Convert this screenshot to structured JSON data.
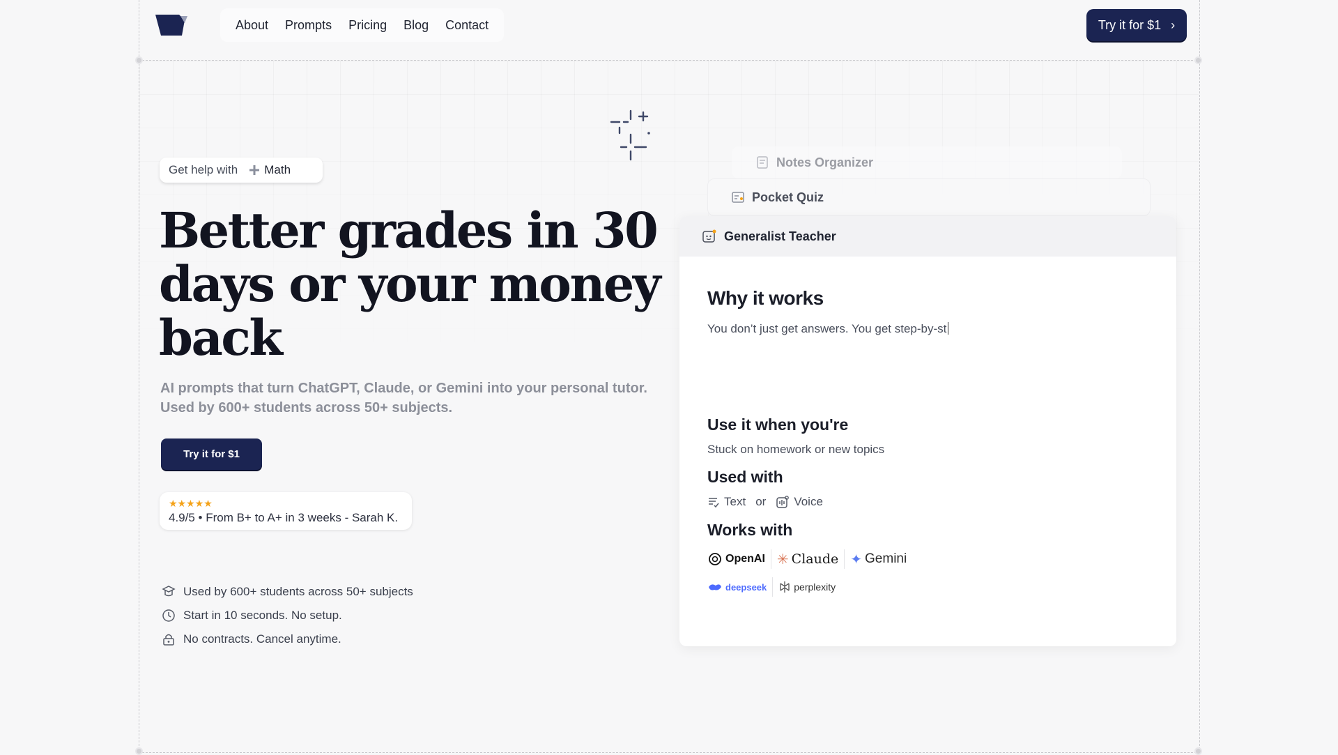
{
  "header": {
    "nav": [
      "About",
      "Prompts",
      "Pricing",
      "Blog",
      "Contact"
    ],
    "cta_label": "Try it for $1",
    "cta_chevron": "›"
  },
  "hero": {
    "help_prefix": "Get help with",
    "help_subject": "Math",
    "headline": "Better grades in 30 days or your money back",
    "subline": "AI prompts that turn ChatGPT, Claude, or Gemini into your personal tutor. Used by 600+ students across 50+ subjects.",
    "cta_label": "Try it for $1",
    "review_stars": "★★★★★",
    "review_text": "4.9/5 • From B+ to A+ in 3 weeks - Sarah K.",
    "bullets": [
      {
        "icon": "graduation-cap-icon",
        "text": "Used by 600+ students across 50+ subjects"
      },
      {
        "icon": "clock-icon",
        "text": "Start in 10 seconds. No setup."
      },
      {
        "icon": "lock-icon",
        "text": "No contracts. Cancel anytime."
      }
    ]
  },
  "cards": {
    "back2_title": "Notes Organizer",
    "back1_title": "Pocket Quiz",
    "main_title": "Generalist Teacher",
    "why_heading": "Why it works",
    "why_text": "You don’t just get answers. You get step-by-st",
    "use_heading": "Use it when you're",
    "use_text": "Stuck on homework or new topics",
    "used_with_heading": "Used with",
    "mode_text": "Text",
    "mode_or": "or",
    "mode_voice": "Voice",
    "works_with_heading": "Works with",
    "brands_row1": [
      "OpenAI",
      "Claude",
      "Gemini"
    ],
    "brands_row2": [
      "deepseek",
      "perplexity"
    ]
  },
  "colors": {
    "accent": "#1b2452",
    "star": "#f4a218",
    "background": "#f7f7f8"
  }
}
